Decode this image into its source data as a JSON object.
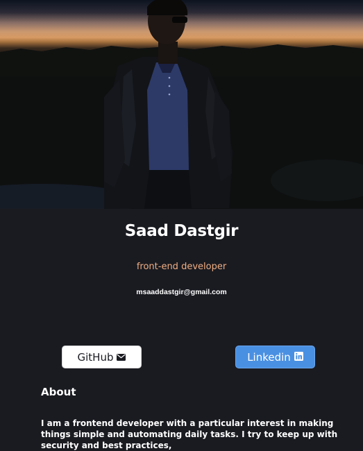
{
  "profile": {
    "name": "Saad Dastgir",
    "role": "front-end developer",
    "email": "msaaddastgir@gmail.com"
  },
  "links": {
    "github_label": "GitHub",
    "linkedin_label": "Linkedin"
  },
  "about": {
    "heading": "About",
    "text": "I am a frontend developer with a particular interest in making things simple and automating daily tasks. I try to keep up with security and best practices,"
  },
  "icons": {
    "github": "envelope-icon",
    "linkedin": "linkedin-icon"
  },
  "colors": {
    "background": "#1a1b21",
    "role_accent": "#f0ae84",
    "linkedin_button": "#4a90e2",
    "github_button": "#ffffff"
  }
}
